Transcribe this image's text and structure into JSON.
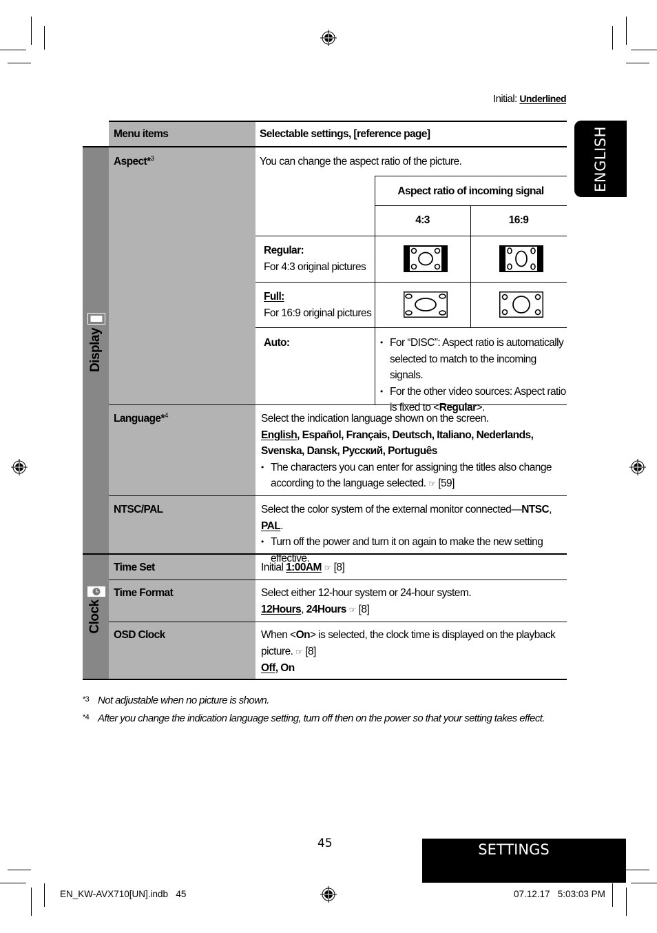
{
  "initial_note": {
    "label": "Initial:",
    "value": "Underlined"
  },
  "language_tab": "ENGLISH",
  "table": {
    "header": {
      "col1": "Menu items",
      "col2": "Selectable settings, [reference page]"
    },
    "groups": [
      {
        "name": "Display",
        "icon": "display-icon"
      },
      {
        "name": "Clock",
        "icon": "clock-icon"
      }
    ],
    "aspect": {
      "label": "Aspect*",
      "sup": "3",
      "intro": "You can change the aspect ratio of the picture.",
      "subheader": "Aspect ratio of incoming signal",
      "col_43": "4:3",
      "col_169": "16:9",
      "regular": {
        "label": "Regular:",
        "desc": "For 4:3 original pictures"
      },
      "full": {
        "label": "Full:",
        "desc": "For 16:9 original pictures"
      },
      "auto": {
        "label": "Auto:",
        "bullet1": "For “DISC”: Aspect ratio is automatically selected to match to the incoming signals.",
        "bullet2_pre": "For the other video sources: Aspect ratio is fixed to <",
        "bullet2_bold": "Regular",
        "bullet2_post": ">."
      }
    },
    "language": {
      "label": "Language*",
      "sup": "4",
      "line1": "Select the indication language shown on the screen.",
      "default_option": "English",
      "options_rest1": ", Español, Français, Deutsch, Italiano, Nederlands,",
      "options_rest2": "Svenska, Dansk, Русский, Português",
      "bullet": "The characters you can enter for assigning the titles also change according to the language selected.",
      "ref": "[59]"
    },
    "ntsc_pal": {
      "label": "NTSC/PAL",
      "line1_pre": "Select the color system of the external monitor connected—",
      "opt1": "NTSC",
      "sep": ", ",
      "opt2_default": "PAL",
      "end": ".",
      "bullet": "Turn off the power and turn it on again to make the new setting effective."
    },
    "time_set": {
      "label": "Time Set",
      "pre": "Initial ",
      "value": "1:00AM",
      "ref": "[8]"
    },
    "time_format": {
      "label": "Time Format",
      "line1": "Select either 12-hour system or 24-hour system.",
      "opt1_default": "12Hours",
      "sep": ", ",
      "opt2": "24Hours",
      "ref": "[8]"
    },
    "osd_clock": {
      "label": "OSD Clock",
      "line1_pre": "When <",
      "line1_bold": "On",
      "line1_post": "> is selected, the clock time is displayed on the playback",
      "line2": "picture.",
      "ref": "[8]",
      "opt1_default": "Off",
      "opt2": ", On"
    }
  },
  "footnotes": [
    {
      "mark": "*3",
      "text": "Not adjustable when no picture is shown."
    },
    {
      "mark": "*4",
      "text": "After you change the indication language setting, turn off then on the power so that your setting takes effect."
    }
  ],
  "page_number": "45",
  "section_tab": "SETTINGS",
  "print_info": {
    "file": "EN_KW-AVX710[UN].indb   45",
    "datetime": "07.12.17   5:03:03 PM"
  },
  "ref_symbol": "☞"
}
